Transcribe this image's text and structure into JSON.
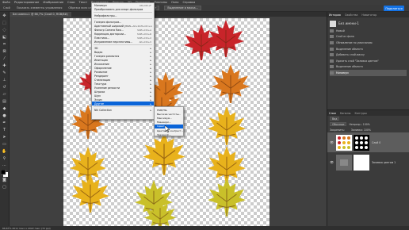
{
  "menubar": {
    "items": [
      "Файл",
      "Редактирование",
      "Изображение",
      "Слои",
      "Текст",
      "Выделение",
      "Фильтр",
      "3D",
      "Просмотр",
      "Плагины",
      "Окно",
      "Справка"
    ]
  },
  "options": {
    "items": [
      "Слой",
      "Показать элементы управления",
      "Обрезка всех слоев",
      "Удалить края"
    ],
    "select_subject": "Выделить объект",
    "select_mask": "Выделение и маска..."
  },
  "share": "Поделиться",
  "doc_tab": "Без имени-1 @ 66,7% (Слой 0, RGB/8#)",
  "status": "66,67%  2011 пикс x 2022 пикс (72 ppi)",
  "filter_menu": {
    "items": [
      {
        "label": "Минимум",
        "shortcut": "Alt+Ctrl+F"
      },
      {
        "label": "Преобразовать для смарт-фильтров",
        "shortcut": ""
      },
      {
        "sep": true
      },
      {
        "label": "Нейрофильтры...",
        "shortcut": ""
      },
      {
        "sep": true
      },
      {
        "label": "Галерея фильтров...",
        "shortcut": ""
      },
      {
        "label": "Адаптивный широкий угол...",
        "shortcut": "Alt+Shift+Ctrl+A"
      },
      {
        "label": "Фильтр Camera Raw...",
        "shortcut": "Shift+Ctrl+A"
      },
      {
        "label": "Коррекция дисторсии...",
        "shortcut": "Shift+Ctrl+R"
      },
      {
        "label": "Пластика...",
        "shortcut": "Shift+Ctrl+X"
      },
      {
        "label": "Исправление перспективы...",
        "shortcut": "Alt+Ctrl+V"
      },
      {
        "sep": true
      },
      {
        "label": "3D",
        "arrow": true
      },
      {
        "label": "Видео",
        "arrow": true
      },
      {
        "label": "Галерея размытия",
        "arrow": true
      },
      {
        "label": "Имитация",
        "arrow": true
      },
      {
        "label": "Искажение",
        "arrow": true
      },
      {
        "label": "Оформление",
        "arrow": true
      },
      {
        "label": "Размытие",
        "arrow": true
      },
      {
        "label": "Рендеринг",
        "arrow": true
      },
      {
        "label": "Стилизация",
        "arrow": true
      },
      {
        "label": "Текстура",
        "arrow": true
      },
      {
        "label": "Усиление резкости",
        "arrow": true
      },
      {
        "label": "Штрихи",
        "arrow": true
      },
      {
        "label": "Шум",
        "arrow": true
      },
      {
        "label": "Эскиз",
        "arrow": true
      },
      {
        "label": "Другое",
        "arrow": true,
        "highlight": true
      },
      {
        "sep": true
      },
      {
        "label": "Nik Collection",
        "arrow": true
      }
    ]
  },
  "submenu": {
    "items": [
      {
        "label": "HSB/HSL"
      },
      {
        "label": "Высокие частоты..."
      },
      {
        "label": "Максимум..."
      },
      {
        "label": "Минимум..."
      },
      {
        "label": "Сдвиг...",
        "highlight": true
      },
      {
        "label": "Цветовой контраст..."
      },
      {
        "label": "Заказной..."
      }
    ]
  },
  "history": {
    "tabs": [
      "История",
      "Свойства",
      "Навигатор"
    ],
    "snapshot": "Без имени-1",
    "items": [
      "Новый",
      "Слой из фона",
      "Обновление по умолчанию",
      "Выделение объекта",
      "Добавить слой-маску",
      "Удалить слой \"Заливка цветом\"",
      "Выделение объекта",
      "Минимум"
    ]
  },
  "layers": {
    "tabs": [
      "Слои",
      "Каналы",
      "Контуры"
    ],
    "kind": "Вид",
    "blend": "Обычные",
    "opacity_label": "Непрозр.: 100%",
    "lock_label": "Закрепить:",
    "fill_label": "Заливка: 100%",
    "items": [
      {
        "name": "Слой 0"
      },
      {
        "name": "Заливка цветом 1"
      }
    ]
  },
  "colors": {
    "accent": "#1473e6",
    "menu_highlight": "#0a64d8",
    "leaf_red": "#c8242a",
    "leaf_orange": "#d9771e",
    "leaf_yellow": "#e8b21c",
    "leaf_green_yellow": "#c9c02a"
  }
}
